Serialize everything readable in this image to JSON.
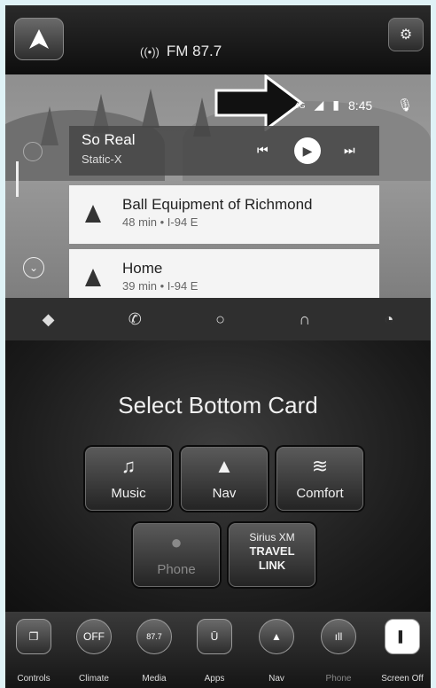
{
  "top": {
    "radio_label": "FM 87.7"
  },
  "status": {
    "network": "4G",
    "time": "8:45"
  },
  "music": {
    "title": "So Real",
    "artist": "Static-X"
  },
  "nav_cards": [
    {
      "title": "Ball Equipment of Richmond",
      "subtitle": "48 min • I-94 E"
    },
    {
      "title": "Home",
      "subtitle": "39 min • I-94 E"
    }
  ],
  "panel": {
    "title": "Select Bottom Card",
    "tiles": [
      {
        "label": "Music",
        "icon": "music-note-icon"
      },
      {
        "label": "Nav",
        "icon": "nav-arrow-icon"
      },
      {
        "label": "Comfort",
        "icon": "seat-climate-icon"
      },
      {
        "label": "Phone",
        "icon": "person-icon"
      }
    ],
    "sirius": {
      "line1": "Sirius XM",
      "line2": "TRAVEL",
      "line3": "LINK"
    }
  },
  "dock": {
    "items": [
      {
        "label": "Controls"
      },
      {
        "label": "Climate",
        "badge": "OFF"
      },
      {
        "label": "Media",
        "badge": "87.7"
      },
      {
        "label": "Apps"
      },
      {
        "label": "Nav"
      },
      {
        "label": "Phone"
      },
      {
        "label": "Screen Off"
      }
    ]
  }
}
